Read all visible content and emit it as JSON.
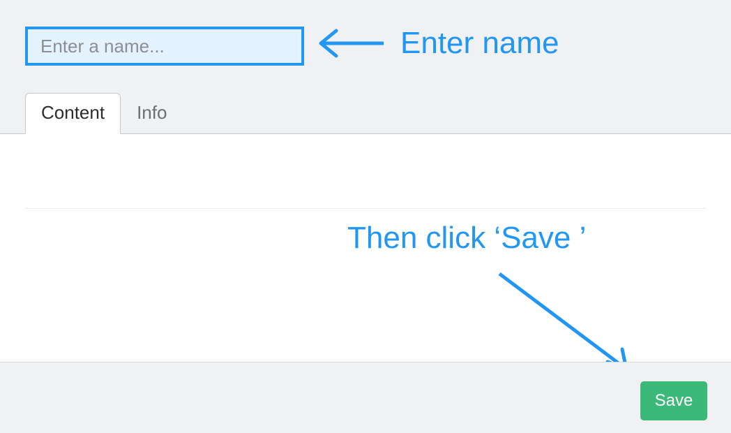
{
  "input": {
    "placeholder": "Enter a name...",
    "value": ""
  },
  "tabs": {
    "content": "Content",
    "info": "Info"
  },
  "buttons": {
    "save": "Save"
  },
  "annotations": {
    "enter_name": "Enter name",
    "then_save": "Then click ‘Save ’"
  },
  "colors": {
    "accent": "#2196f3",
    "save_button": "#3cb878"
  }
}
